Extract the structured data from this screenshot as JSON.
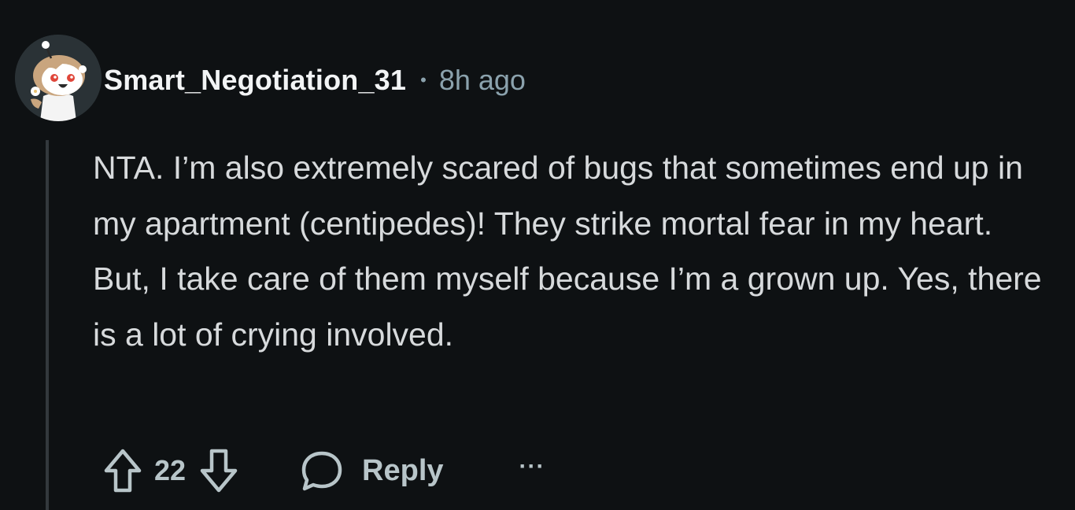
{
  "comment": {
    "author": "Smart_Negotiation_31",
    "separator": "•",
    "time_ago": "8h ago",
    "avatar_icon": "snoo-avatar-icon",
    "body": "NTA. I’m also extremely scared of bugs that sometimes end up in my apartment (centipedes)! They strike mortal fear in my heart. But, I take care of them myself because I’m a grown up. Yes, there is a lot of crying involved.",
    "score": "22",
    "reply_label": "Reply",
    "more_label": "···"
  },
  "icons": {
    "upvote": "upvote-arrow-icon",
    "downvote": "downvote-arrow-icon",
    "reply": "speech-bubble-icon",
    "more": "ellipsis-icon"
  },
  "colors": {
    "background": "#0e1113",
    "username": "#f2f4f5",
    "meta": "#8ba2ad",
    "body_text": "#d7dadc",
    "actions": "#b8c5c9",
    "thread_line": "#33393d"
  }
}
